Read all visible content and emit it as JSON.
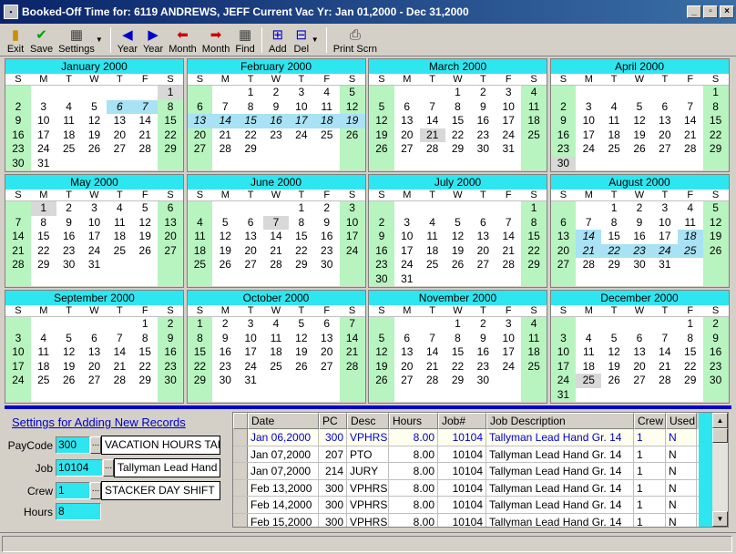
{
  "window": {
    "title": "Booked-Off Time for: 6119   ANDREWS,  JEFF   Current Vac Yr: Jan 01,2000 - Dec 31,2000",
    "min": "_",
    "max": "▫",
    "close": "×"
  },
  "toolbar": [
    {
      "name": "exit-button",
      "icon": "exit-icon",
      "glyph": "▮",
      "color": "#c89000",
      "label": "Exit",
      "u": "E"
    },
    {
      "name": "save-button",
      "icon": "checkmark-icon",
      "glyph": "✔",
      "color": "#00a000",
      "label": "Save",
      "u": "S"
    },
    {
      "name": "settings-button",
      "icon": "settings-icon",
      "glyph": "▦",
      "color": "#404040",
      "label": "Settings",
      "u": "t",
      "dropdown": true
    },
    {
      "sep": true
    },
    {
      "name": "prev-year-button",
      "icon": "left-triangle-icon",
      "glyph": "◀",
      "color": "#0000c8",
      "label": "Year",
      "u": "Y"
    },
    {
      "name": "next-year-button",
      "icon": "right-triangle-icon",
      "glyph": "▶",
      "color": "#0000c8",
      "label": "Year",
      "u": "a"
    },
    {
      "name": "prev-month-button",
      "icon": "left-arrow-icon",
      "glyph": "⬅",
      "color": "#c80000",
      "label": "Month",
      "u": "M"
    },
    {
      "name": "next-month-button",
      "icon": "right-arrow-icon",
      "glyph": "➡",
      "color": "#c80000",
      "label": "Month",
      "u": "o"
    },
    {
      "name": "find-button",
      "icon": "calendar-icon",
      "glyph": "▦",
      "color": "#404040",
      "label": "Find",
      "u": "F"
    },
    {
      "sep": true
    },
    {
      "name": "add-button",
      "icon": "add-icon",
      "glyph": "⊞",
      "color": "#0000c8",
      "label": "Add",
      "u": "A"
    },
    {
      "name": "delete-button",
      "icon": "delete-icon",
      "glyph": "⊟",
      "color": "#0000c8",
      "label": "Del",
      "u": "D",
      "dropdown": true
    },
    {
      "sep": true
    },
    {
      "name": "print-screen-button",
      "icon": "printer-icon",
      "glyph": "⎙",
      "color": "#404040",
      "label": "Print Scrn",
      "u": "P"
    }
  ],
  "weekday_headers": [
    "S",
    "M",
    "T",
    "W",
    "T",
    "F",
    "S"
  ],
  "months": [
    {
      "name": "January 2000",
      "start": 6,
      "days": 31,
      "booked": [
        6,
        7
      ],
      "highlight": [
        1
      ]
    },
    {
      "name": "February 2000",
      "start": 2,
      "days": 29,
      "booked": [
        13,
        14,
        15,
        16,
        17,
        18,
        19
      ],
      "highlight": []
    },
    {
      "name": "March 2000",
      "start": 3,
      "days": 31,
      "booked": [],
      "highlight": [
        21
      ]
    },
    {
      "name": "April 2000",
      "start": 6,
      "days": 30,
      "booked": [],
      "highlight": [
        30
      ]
    },
    {
      "name": "May 2000",
      "start": 1,
      "days": 31,
      "booked": [],
      "highlight": [
        1
      ]
    },
    {
      "name": "June 2000",
      "start": 4,
      "days": 30,
      "booked": [],
      "highlight": [
        7
      ]
    },
    {
      "name": "July 2000",
      "start": 6,
      "days": 31,
      "booked": [],
      "highlight": []
    },
    {
      "name": "August 2000",
      "start": 2,
      "days": 31,
      "booked": [
        14,
        18,
        21,
        22,
        23,
        24,
        25
      ],
      "highlight": []
    },
    {
      "name": "September 2000",
      "start": 5,
      "days": 30,
      "booked": [],
      "highlight": []
    },
    {
      "name": "October 2000",
      "start": 0,
      "days": 31,
      "booked": [],
      "highlight": []
    },
    {
      "name": "November 2000",
      "start": 3,
      "days": 30,
      "booked": [],
      "highlight": []
    },
    {
      "name": "December 2000",
      "start": 5,
      "days": 31,
      "booked": [],
      "highlight": [
        25
      ]
    }
  ],
  "settings": {
    "title": "Settings for Adding New Records",
    "paycode_label": "PayCode",
    "paycode": "300",
    "paycode_desc": "VACATION HOURS TAKE",
    "job_label": "Job",
    "job": "10104",
    "job_desc": "Tallyman Lead Hand Gr.",
    "crew_label": "Crew",
    "crew": "1",
    "crew_desc": "STACKER DAY SHIFT",
    "hours_label": "Hours",
    "hours": "8",
    "lookup": "..."
  },
  "table": {
    "columns": [
      "Date",
      "PC",
      "Desc",
      "Hours",
      "Job#",
      "Job Description",
      "Crew",
      "Used"
    ],
    "rows": [
      [
        "Jan 06,2000",
        "300",
        "VPHRS",
        "8.00",
        "10104",
        "Tallyman Lead Hand Gr. 14",
        "1",
        "N"
      ],
      [
        "Jan 07,2000",
        "207",
        "PTO",
        "8.00",
        "10104",
        "Tallyman Lead Hand Gr. 14",
        "1",
        "N"
      ],
      [
        "Jan 07,2000",
        "214",
        "JURY",
        "8.00",
        "10104",
        "Tallyman Lead Hand Gr. 14",
        "1",
        "N"
      ],
      [
        "Feb 13,2000",
        "300",
        "VPHRS",
        "8.00",
        "10104",
        "Tallyman Lead Hand Gr. 14",
        "1",
        "N"
      ],
      [
        "Feb 14,2000",
        "300",
        "VPHRS",
        "8.00",
        "10104",
        "Tallyman Lead Hand Gr. 14",
        "1",
        "N"
      ],
      [
        "Feb 15,2000",
        "300",
        "VPHRS",
        "8.00",
        "10104",
        "Tallyman Lead Hand Gr. 14",
        "1",
        "N"
      ]
    ]
  },
  "scroll": {
    "up": "▲",
    "down": "▼"
  }
}
